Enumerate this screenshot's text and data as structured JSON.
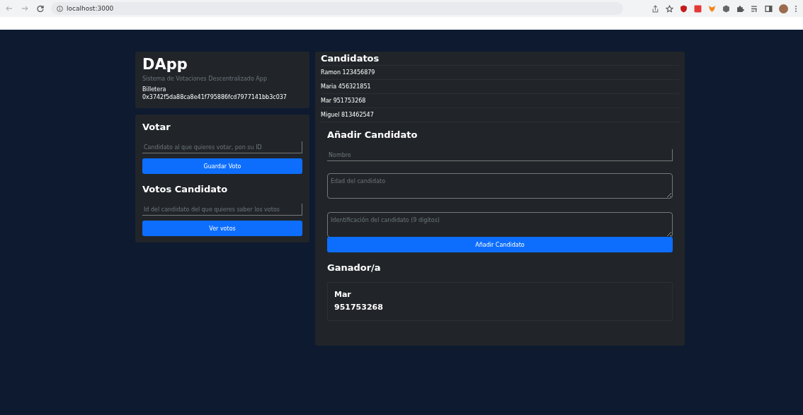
{
  "browser": {
    "url": "localhost:3000"
  },
  "header": {
    "title": "DApp",
    "subtitle": "Sistema de Votaciones Descentralizado App",
    "wallet_label": "Billetera",
    "wallet_address": "0x3742f5da88ca8e41f795886fcd7977141bb3c037"
  },
  "vote": {
    "title": "Votar",
    "placeholder": "Candidato al que quieres votar, pon su ID",
    "button": "Guardar Voto"
  },
  "votes_lookup": {
    "title": "Votos Candidato",
    "placeholder": "Id del candidato del que quieres saber los votos",
    "button": "Ver votos"
  },
  "candidates": {
    "title": "Candidatos",
    "items": [
      "Ramon 123456879",
      "Maria 456321851",
      "Mar 951753268",
      "Miguel 813462547"
    ]
  },
  "add_candidate": {
    "title": "Añadir Candidato",
    "name_placeholder": "Nombre",
    "age_placeholder": "Edad del candidato",
    "id_placeholder": "Identificación del candidato (9 digitos)",
    "button": "Añadir Candidato"
  },
  "winner": {
    "title": "Ganador/a",
    "name": "Mar",
    "id": "951753268"
  }
}
